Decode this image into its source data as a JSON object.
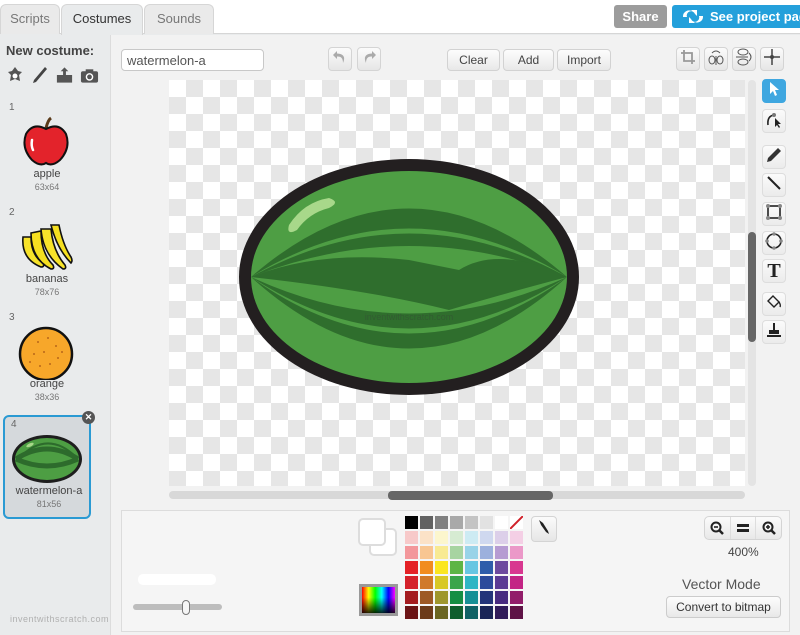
{
  "tabs": [
    {
      "label": "Scripts",
      "active": false
    },
    {
      "label": "Costumes",
      "active": true
    },
    {
      "label": "Sounds",
      "active": false
    }
  ],
  "header": {
    "share_label": "Share",
    "project_page_label": "See project page"
  },
  "sidebar": {
    "new_costume_label": "New costume:",
    "new_costume_icons": [
      "choose-from-library-icon",
      "paint-new-icon",
      "upload-icon",
      "camera-icon"
    ],
    "costumes": [
      {
        "index": "1",
        "name": "apple",
        "size": "63x64",
        "selected": false
      },
      {
        "index": "2",
        "name": "bananas",
        "size": "78x76",
        "selected": false
      },
      {
        "index": "3",
        "name": "orange",
        "size": "38x36",
        "selected": false
      },
      {
        "index": "4",
        "name": "watermelon-a",
        "size": "81x56",
        "selected": true
      }
    ],
    "watermark": "inventwithscratch.com"
  },
  "editor": {
    "costume_name_value": "watermelon-a",
    "toolbar": {
      "undo_icon": "undo-icon",
      "redo_icon": "redo-icon",
      "clear_label": "Clear",
      "add_label": "Add",
      "import_label": "Import",
      "right_icons": [
        "crop-icon",
        "flip-horizontal-icon",
        "flip-vertical-icon",
        "set-center-icon"
      ]
    },
    "tools": [
      "select",
      "reshape",
      "pencil",
      "line",
      "rectangle",
      "ellipse",
      "text",
      "fill-color",
      "duplicate"
    ],
    "active_tool": "select",
    "canvas_watermark": "inventwithscratch.com",
    "vertical_scroll_position": 0.55,
    "horizontal_scroll_position": 0.5
  },
  "bottom": {
    "stroke_width_fraction": 0.6,
    "fill_color": "#ffffff",
    "stroke_color": "#ffffff",
    "palette": [
      [
        "#000000",
        "#616161",
        "#808080",
        "#a9a9a9",
        "#c4c4c4",
        "#e2e2e2",
        "#ffffff",
        "none"
      ],
      [
        "#f7c9c9",
        "#fbe2c7",
        "#fcf6cd",
        "#d6ebd2",
        "#cdebf3",
        "#cfd8ef",
        "#dccfe9",
        "#f4cfe5"
      ],
      [
        "#f3979b",
        "#f8c692",
        "#f8ea92",
        "#a7d4a1",
        "#98d3e8",
        "#9cb0dd",
        "#b69bd2",
        "#eb98c8"
      ],
      [
        "#e42126",
        "#f18c1f",
        "#fbe620",
        "#5db545",
        "#67c6e2",
        "#2e5daa",
        "#6d4a9e",
        "#d83790"
      ],
      [
        "#d4212a",
        "#d0792a",
        "#d8c826",
        "#3ba54a",
        "#2eb5c4",
        "#2c4b9b",
        "#5b3b94",
        "#c32485"
      ],
      [
        "#a41c20",
        "#9d5925",
        "#9f972c",
        "#158e43",
        "#168f95",
        "#23347a",
        "#482b80",
        "#921d6a"
      ],
      [
        "#6b1416",
        "#6c3b1a",
        "#6b6621",
        "#0f5e2d",
        "#0f6165",
        "#1a2557",
        "#311c5a",
        "#5f1346"
      ]
    ],
    "zoom_out_icon": "zoom-out-icon",
    "zoom_reset_icon": "zoom-reset-icon",
    "zoom_in_icon": "zoom-in-icon",
    "zoom_level": "400%",
    "mode_label": "Vector Mode",
    "convert_label": "Convert to bitmap"
  }
}
